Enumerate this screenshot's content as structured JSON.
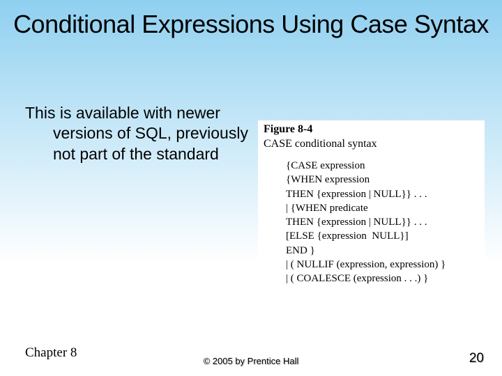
{
  "title": "Conditional Expressions Using Case Syntax",
  "body": "This is available with newer versions of SQL, previously not part of the standard",
  "figure": {
    "label": "Figure 8-4",
    "caption": "CASE conditional syntax",
    "syntax": "{CASE expression\n{WHEN expression\nTHEN {expression | NULL}} . . .\n| {WHEN predicate\nTHEN {expression | NULL}} . . .\n[ELSE {expression  NULL}]\nEND }\n| ( NULLIF (expression, expression) }\n| ( COALESCE (expression . . .) }"
  },
  "footer": {
    "chapter": "Chapter 8",
    "copyright": "© 2005 by Prentice Hall",
    "page": "20"
  }
}
